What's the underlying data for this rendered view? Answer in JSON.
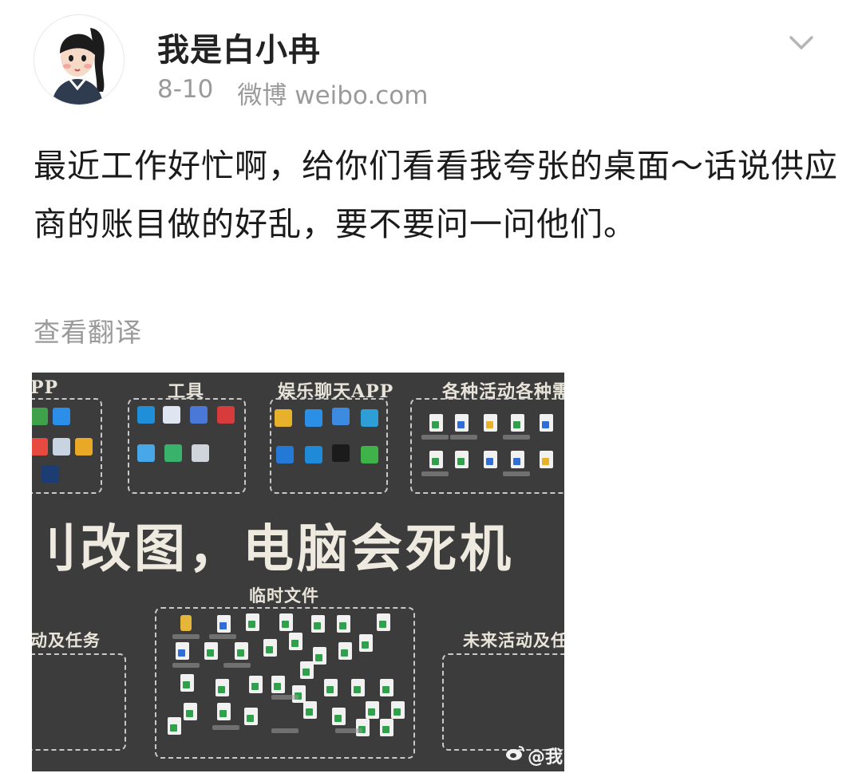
{
  "post": {
    "username": "我是白小冉",
    "date": "8-10",
    "source": "微博 weibo.com",
    "text": "最近工作好忙啊，给你们看看我夸张的桌面～话说供应商的账目做的好乱，要不要问一问他们。",
    "translate_label": "查看翻译"
  },
  "screenshot": {
    "groups": [
      "PP",
      "工具",
      "娱乐聊天APP",
      "各种活动各种需"
    ],
    "big_text": "刂改图，电脑会死机",
    "temp_files_title": "临时文件",
    "left_group": "动及任务",
    "right_group": "未来活动及任",
    "watermark": "@我"
  },
  "icons": [
    "avatar",
    "chevron-down-icon",
    "folder-icon",
    "document-icon",
    "weibo-logo-icon"
  ]
}
